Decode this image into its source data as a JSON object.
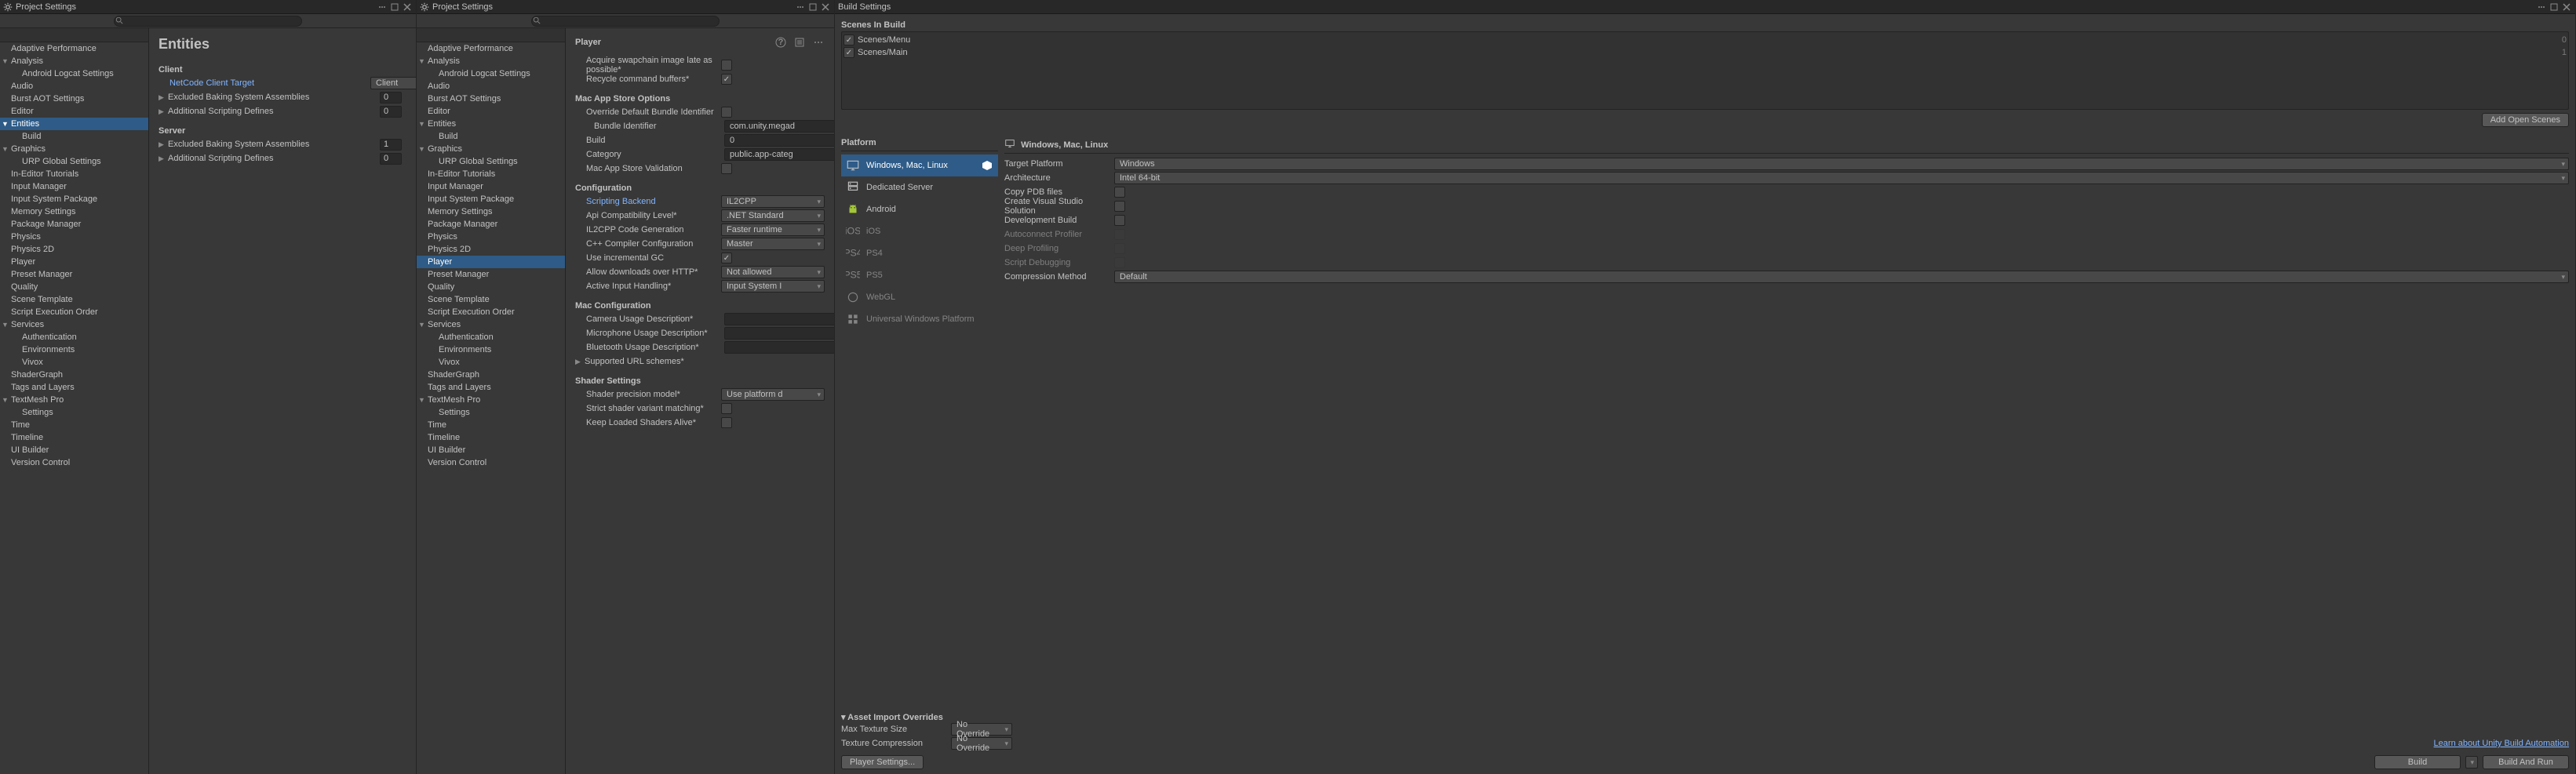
{
  "projectSettings": {
    "title": "Project Settings",
    "searchPlaceholder": "",
    "tree": [
      {
        "label": "Adaptive Performance",
        "sel": false
      },
      {
        "label": "Analysis",
        "expand": true
      },
      {
        "label": "Android Logcat Settings",
        "child": true
      },
      {
        "label": "Audio"
      },
      {
        "label": "Burst AOT Settings"
      },
      {
        "label": "Editor"
      },
      {
        "label": "Entities",
        "expand": true,
        "selA": true
      },
      {
        "label": "Build",
        "child": true
      },
      {
        "label": "Graphics",
        "expand": true
      },
      {
        "label": "URP Global Settings",
        "child": true
      },
      {
        "label": "In-Editor Tutorials"
      },
      {
        "label": "Input Manager"
      },
      {
        "label": "Input System Package"
      },
      {
        "label": "Memory Settings"
      },
      {
        "label": "Package Manager"
      },
      {
        "label": "Physics"
      },
      {
        "label": "Physics 2D"
      },
      {
        "label": "Player",
        "selB": true
      },
      {
        "label": "Preset Manager"
      },
      {
        "label": "Quality"
      },
      {
        "label": "Scene Template"
      },
      {
        "label": "Script Execution Order"
      },
      {
        "label": "Services",
        "expand": true
      },
      {
        "label": "Authentication",
        "child": true
      },
      {
        "label": "Environments",
        "child": true
      },
      {
        "label": "Vivox",
        "child": true
      },
      {
        "label": "ShaderGraph"
      },
      {
        "label": "Tags and Layers"
      },
      {
        "label": "TextMesh Pro",
        "expand": true
      },
      {
        "label": "Settings",
        "child": true
      },
      {
        "label": "Time"
      },
      {
        "label": "Timeline"
      },
      {
        "label": "UI Builder"
      },
      {
        "label": "Version Control"
      }
    ]
  },
  "entities": {
    "title": "Entities",
    "client": "Client",
    "server": "Server",
    "netcodeTarget": "NetCode Client Target",
    "netcodeValue": "Client",
    "excluded": "Excluded Baking System Assemblies",
    "additional": "Additional Scripting Defines",
    "zero": "0",
    "one": "1"
  },
  "player": {
    "title": "Player",
    "rows": [
      {
        "label": "Acquire swapchain image late as possible*",
        "type": "check",
        "checked": false,
        "indent": 1
      },
      {
        "label": "Recycle command buffers*",
        "type": "check",
        "checked": true,
        "indent": 1
      }
    ],
    "macAppStore": {
      "title": "Mac App Store Options",
      "override": "Override Default Bundle Identifier",
      "bundleId": "Bundle Identifier",
      "bundleVal": "com.unity.megad",
      "build": "Build",
      "buildVal": "0",
      "category": "Category",
      "categoryVal": "public.app-categ",
      "validation": "Mac App Store Validation"
    },
    "configuration": {
      "title": "Configuration",
      "backend": "Scripting Backend",
      "backendVal": "IL2CPP",
      "apiCompat": "Api Compatibility Level*",
      "apiVal": ".NET Standard",
      "il2cpp": "IL2CPP Code Generation",
      "il2cppVal": "Faster runtime",
      "cppCompiler": "C++ Compiler Configuration",
      "cppVal": "Master",
      "gc": "Use incremental GC",
      "downloads": "Allow downloads over HTTP*",
      "downloadsVal": "Not allowed",
      "activeInput": "Active Input Handling*",
      "activeInputVal": "Input System I"
    },
    "macConfig": {
      "title": "Mac Configuration",
      "camera": "Camera Usage Description*",
      "mic": "Microphone Usage Description*",
      "bt": "Bluetooth Usage Description*",
      "url": "Supported URL schemes*"
    },
    "shader": {
      "title": "Shader Settings",
      "precision": "Shader precision model*",
      "precisionVal": "Use platform d",
      "strict": "Strict shader variant matching*",
      "keepLoaded": "Keep Loaded Shaders Alive*"
    }
  },
  "buildSettings": {
    "title": "Build Settings",
    "scenesInBuild": "Scenes In Build",
    "scenes": [
      {
        "name": "Scenes/Menu",
        "idx": "0"
      },
      {
        "name": "Scenes/Main",
        "idx": "1"
      }
    ],
    "addOpenScenes": "Add Open Scenes",
    "platformLabel": "Platform",
    "platforms": [
      {
        "name": "Windows, Mac, Linux",
        "selected": true,
        "badge": true,
        "icon": "monitor"
      },
      {
        "name": "Dedicated Server",
        "icon": "server"
      },
      {
        "name": "Android",
        "icon": "android"
      },
      {
        "name": "iOS",
        "dim": true,
        "icon": "ios"
      },
      {
        "name": "PS4",
        "dim": true,
        "icon": "ps4"
      },
      {
        "name": "PS5",
        "dim": true,
        "icon": "ps5"
      },
      {
        "name": "WebGL",
        "dim": true,
        "icon": "webgl"
      },
      {
        "name": "Universal Windows Platform",
        "dim": true,
        "icon": "uwp"
      }
    ],
    "currentPlatform": "Windows, Mac, Linux",
    "settings": {
      "targetPlatform": "Target Platform",
      "targetVal": "Windows",
      "architecture": "Architecture",
      "archVal": "Intel 64-bit",
      "copyPDB": "Copy PDB files",
      "createVS": "Create Visual Studio Solution",
      "devBuild": "Development Build",
      "autoProfiler": "Autoconnect Profiler",
      "deepProfile": "Deep Profiling",
      "scriptDebug": "Script Debugging",
      "compression": "Compression Method",
      "compressionVal": "Default"
    },
    "assetImport": "Asset Import Overrides",
    "maxTexSize": "Max Texture Size",
    "maxTexVal": "No Override",
    "texComp": "Texture Compression",
    "texCompVal": "No Override",
    "learnLink": "Learn about Unity Build Automation",
    "playerSettingsBtn": "Player Settings...",
    "buildBtn": "Build",
    "buildRunBtn": "Build And Run"
  }
}
